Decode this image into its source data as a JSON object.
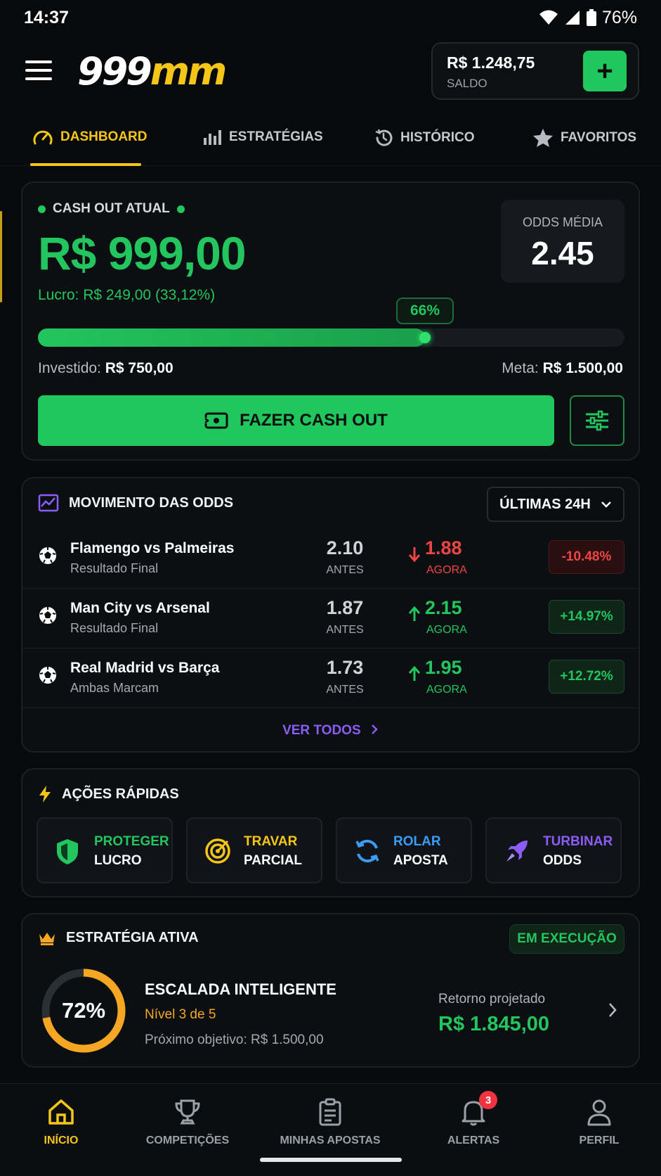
{
  "status_bar": {
    "time": "14:37",
    "battery": "76%"
  },
  "header": {
    "logo_white": "999",
    "logo_yellow": "mm",
    "balance_amount": "R$ 1.248,75",
    "balance_label": "SALDO",
    "add_icon": "plus-icon"
  },
  "tabs": [
    {
      "label": "DASHBOARD",
      "icon": "speedometer-icon",
      "active": true
    },
    {
      "label": "ESTRATÉGIAS",
      "icon": "bar-chart-icon",
      "active": false
    },
    {
      "label": "HISTÓRICO",
      "icon": "history-icon",
      "active": false
    },
    {
      "label": "FAVORITOS",
      "icon": "star-icon",
      "active": false
    }
  ],
  "cashout": {
    "label": "CASH OUT ATUAL",
    "value": "R$ 999,00",
    "profit": "Lucro: R$ 249,00 (33,12%)",
    "odds_label": "ODDS MÉDIA",
    "odds_value": "2.45",
    "progress": 0.66,
    "progress_text": "66%",
    "invested_label": "Investido:",
    "invested_value": "R$ 750,00",
    "goal_label": "Meta:",
    "goal_value": "R$ 1.500,00",
    "button_label": "FAZER CASH OUT"
  },
  "odds_movement": {
    "title": "MOVIMENTO DAS ODDS",
    "period": "ÚLTIMAS 24H",
    "rows": [
      {
        "match": "Flamengo vs Palmeiras",
        "market": "Resultado Final",
        "before": "2.10",
        "before_label": "ANTES",
        "now": "1.88",
        "now_label": "AGORA",
        "direction": "down",
        "change": "-10.48%"
      },
      {
        "match": "Man City vs Arsenal",
        "market": "Resultado Final",
        "before": "1.87",
        "before_label": "ANTES",
        "now": "2.15",
        "now_label": "AGORA",
        "direction": "up",
        "change": "+14.97%"
      },
      {
        "match": "Real Madrid vs Barça",
        "market": "Ambas Marcam",
        "before": "1.73",
        "before_label": "ANTES",
        "now": "1.95",
        "now_label": "AGORA",
        "direction": "up",
        "change": "+12.72%"
      }
    ],
    "view_all": "VER TODOS"
  },
  "quick_actions": {
    "title": "AÇÕES RÁPIDAS",
    "items": [
      {
        "line1": "PROTEGER",
        "line2": "LUCRO",
        "icon": "shield-icon",
        "color": "#22c55e"
      },
      {
        "line1": "TRAVAR",
        "line2": "PARCIAL",
        "icon": "target-icon",
        "color": "#f5c518"
      },
      {
        "line1": "ROLAR",
        "line2": "APOSTA",
        "icon": "refresh-icon",
        "color": "#3b9cf6"
      },
      {
        "line1": "TURBINAR",
        "line2": "ODDS",
        "icon": "rocket-icon",
        "color": "#8b5cf6"
      }
    ]
  },
  "strategy": {
    "title": "ESTRATÉGIA ATIVA",
    "status": "EM EXECUÇÃO",
    "progress": 0.72,
    "progress_text": "72%",
    "name": "ESCALADA INTELIGENTE",
    "level": "Nível 3 de 5",
    "next_goal": "Próximo objetivo: R$ 1.500,00",
    "projected_label": "Retorno projetado",
    "projected_value": "R$ 1.845,00"
  },
  "bottom_nav": [
    {
      "label": "INÍCIO",
      "icon": "home-icon",
      "active": true
    },
    {
      "label": "COMPETIÇÕES",
      "icon": "trophy-icon",
      "active": false
    },
    {
      "label": "MINHAS APOSTAS",
      "icon": "clipboard-icon",
      "active": false
    },
    {
      "label": "ALERTAS",
      "icon": "bell-icon",
      "active": false,
      "badge": "3"
    },
    {
      "label": "PERFIL",
      "icon": "user-icon",
      "active": false
    }
  ],
  "colors": {
    "accent_green": "#22c55e",
    "accent_yellow": "#f5c518",
    "negative_red": "#ef4444",
    "purple": "#8b5cf6",
    "background": "#07090b"
  }
}
